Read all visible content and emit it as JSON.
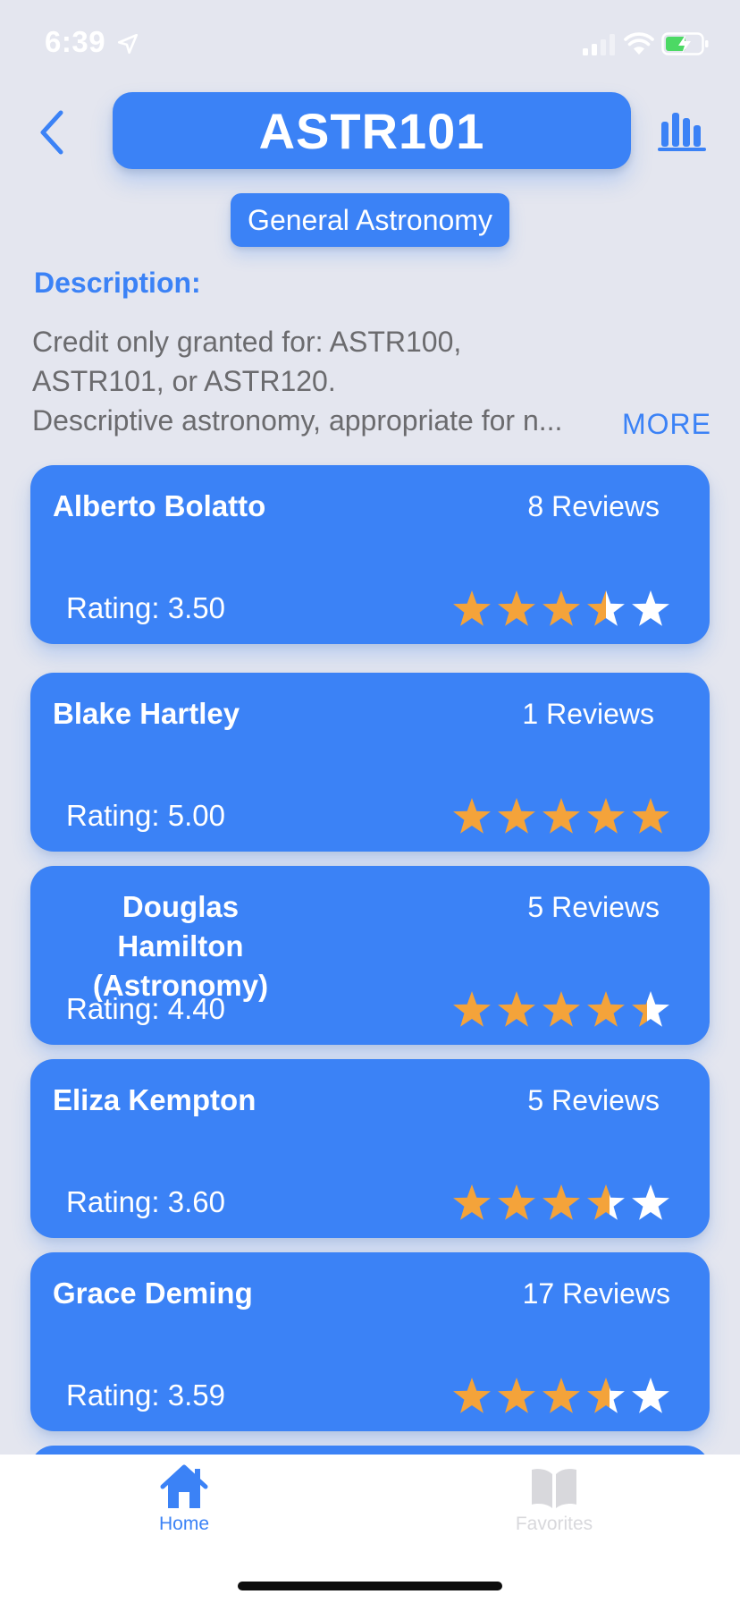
{
  "status_bar": {
    "time": "6:39",
    "icons": [
      "location-arrow-icon",
      "cellular-signal-icon",
      "wifi-icon",
      "battery-charging-icon"
    ]
  },
  "header": {
    "back_icon": "chevron-left-icon",
    "course_code": "ASTR101",
    "course_name": "General Astronomy",
    "stats_icon": "bar-chart-icon"
  },
  "description": {
    "heading": "Description:",
    "lines": [
      "Credit only granted for: ASTR100,",
      "ASTR101, or ASTR120.",
      "Descriptive astronomy, appropriate for n..."
    ],
    "more_label": "MORE"
  },
  "colors": {
    "accent": "#3b82f6",
    "star_filled": "#f4a33a",
    "star_empty": "#ffffff",
    "background": "#e4e6ef"
  },
  "professors": [
    {
      "name_lines": [
        "Alberto Bolatto"
      ],
      "reviews": "8 Reviews",
      "rating_text": "Rating: 3.50",
      "rating": 3.5
    },
    {
      "name_lines": [
        "Blake Hartley"
      ],
      "reviews": "1 Reviews",
      "rating_text": "Rating: 5.00",
      "rating": 5.0
    },
    {
      "name_lines": [
        "Douglas Hamilton",
        "(Astronomy)"
      ],
      "reviews": "5 Reviews",
      "rating_text": "Rating: 4.40",
      "rating": 4.4
    },
    {
      "name_lines": [
        "Eliza Kempton"
      ],
      "reviews": "5 Reviews",
      "rating_text": "Rating: 3.60",
      "rating": 3.6
    },
    {
      "name_lines": [
        "Grace Deming"
      ],
      "reviews": "17 Reviews",
      "rating_text": "Rating: 3.59",
      "rating": 3.59
    }
  ],
  "tab_bar": {
    "tabs": [
      {
        "label": "Home",
        "icon": "house-icon",
        "active": true
      },
      {
        "label": "Favorites",
        "icon": "open-book-icon",
        "active": false
      }
    ]
  }
}
